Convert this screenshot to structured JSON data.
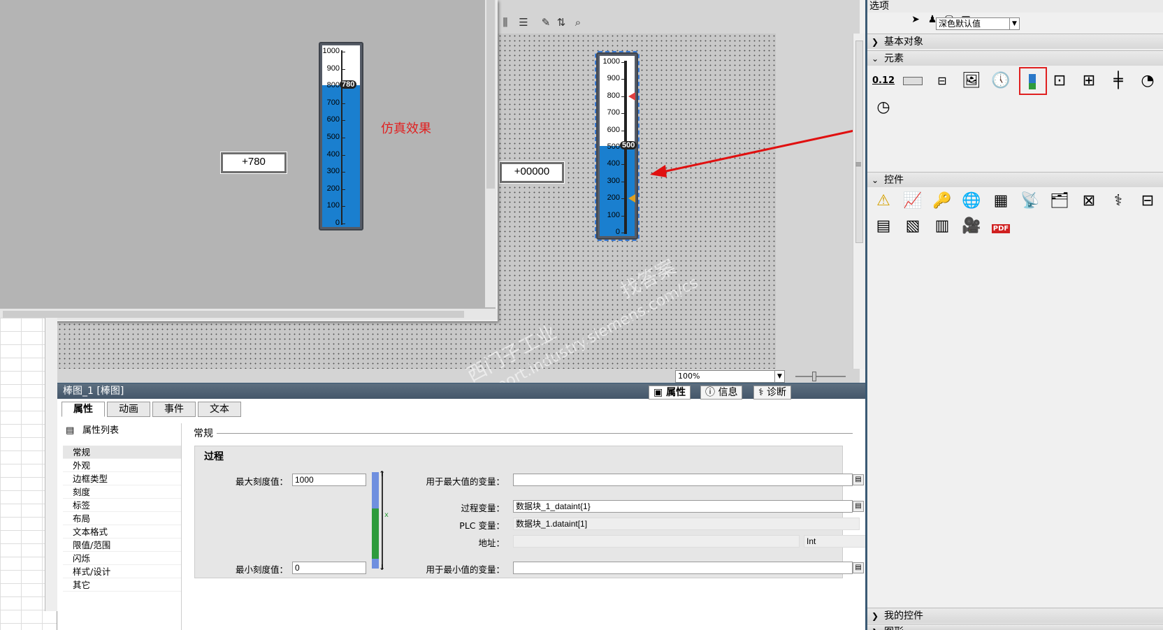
{
  "simulation": {
    "label": "仿真效果",
    "io_value": "+780",
    "bar_value_tag": "780",
    "bar_ticks": [
      "1000",
      "900",
      "800",
      "700",
      "600",
      "500",
      "400",
      "300",
      "200",
      "100",
      "0"
    ],
    "bar_fill_fraction": 0.78
  },
  "design": {
    "io_value": "+00000",
    "bar_value_tag": "500",
    "bar_ticks": [
      "1000",
      "900",
      "800",
      "700",
      "600",
      "500",
      "400",
      "300",
      "200",
      "100",
      "0"
    ],
    "bar_fill_fraction": 0.5,
    "upper_limit_marker_value": 800,
    "lower_limit_marker_value": 200
  },
  "canvas": {
    "zoom": "100%"
  },
  "watermark": {
    "line1": "西门子工业",
    "line2": "support.industry.siemens.com/cs",
    "line3": "找答案"
  },
  "properties": {
    "title": "棒图_1 [棒图]",
    "right_tabs": [
      "属性",
      "信息",
      "诊断"
    ],
    "tabs": [
      "属性",
      "动画",
      "事件",
      "文本"
    ],
    "list_header": "属性列表",
    "list_items": [
      "常规",
      "外观",
      "边框类型",
      "刻度",
      "标签",
      "布局",
      "文本格式",
      "限值/范围",
      "闪烁",
      "样式/设计",
      "其它"
    ],
    "section": "常规",
    "group": "过程",
    "max_scale_label": "最大刻度值：",
    "max_scale_value": "1000",
    "min_scale_label": "最小刻度值：",
    "min_scale_value": "0",
    "max_var_label": "用于最大值的变量：",
    "max_var_value": "",
    "process_var_label": "过程变量：",
    "process_var_value": "数据块_1_dataint{1}",
    "plc_var_label": "PLC 变量：",
    "plc_var_value": "数据块_1.dataint[1]",
    "address_label": "地址：",
    "address_value": "",
    "type_value": "Int",
    "min_var_label": "用于最小值的变量：",
    "min_var_value": ""
  },
  "toolbox": {
    "header": "选项",
    "style_value": "深色默认值",
    "sections": {
      "basic": "基本对象",
      "elements": "元素",
      "controls": "控件",
      "my_controls": "我的控件",
      "graphics": "图形"
    },
    "element_io_text": "0.12",
    "pdf_text": "PDF"
  }
}
